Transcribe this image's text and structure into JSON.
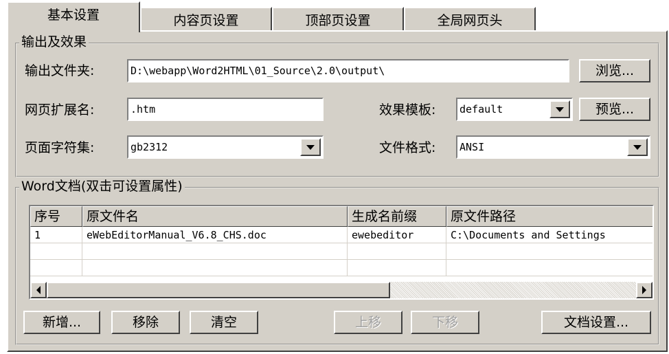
{
  "tabs": [
    {
      "label": "基本设置",
      "active": true
    },
    {
      "label": "内容页设置",
      "active": false
    },
    {
      "label": "顶部页设置",
      "active": false
    },
    {
      "label": "全局网页头",
      "active": false
    }
  ],
  "output_group": {
    "title": "输出及效果",
    "folder_label": "输出文件夹:",
    "folder_value": "D:\\webapp\\Word2HTML\\01_Source\\2.0\\output\\",
    "browse_button": "浏览...",
    "ext_label": "网页扩展名:",
    "ext_value": ".htm",
    "template_label": "效果模板:",
    "template_value": "default",
    "preview_button": "预览...",
    "charset_label": "页面字符集:",
    "charset_value": "gb2312",
    "format_label": "文件格式:",
    "format_value": "ANSI"
  },
  "word_group": {
    "title": "Word文档(双击可设置属性)",
    "columns": [
      "序号",
      "原文件名",
      "生成名前缀",
      "原文件路径"
    ],
    "rows": [
      [
        "1",
        "eWebEditorManual_V6.8_CHS.doc",
        "ewebeditor",
        "C:\\Documents and Settings"
      ]
    ],
    "scroll_position": 0
  },
  "buttons": {
    "add": "新增...",
    "remove": "移除",
    "clear": "清空",
    "move_up": "上移",
    "move_down": "下移",
    "doc_settings": "文档设置..."
  },
  "colors": {
    "face": "#d4d0c8",
    "disabled_text": "#a0a0a0"
  }
}
